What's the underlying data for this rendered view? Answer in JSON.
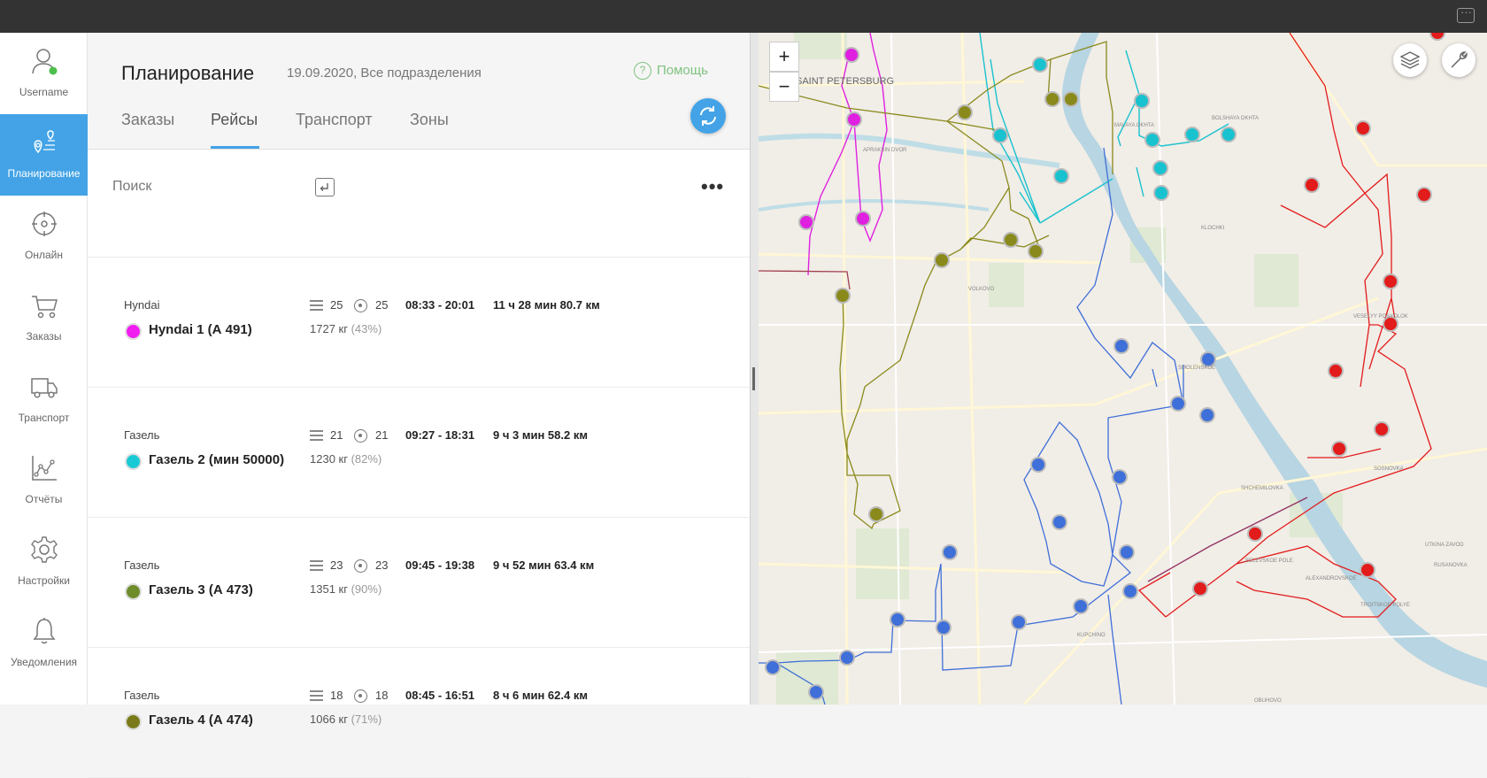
{
  "sidebar": {
    "items": [
      {
        "label": "Username",
        "icon": "user-icon"
      },
      {
        "label": "Планирование",
        "icon": "route-planning-icon",
        "active": true
      },
      {
        "label": "Онлайн",
        "icon": "crosshair-icon"
      },
      {
        "label": "Заказы",
        "icon": "cart-icon"
      },
      {
        "label": "Транспорт",
        "icon": "truck-icon"
      },
      {
        "label": "Отчёты",
        "icon": "chart-icon"
      },
      {
        "label": "Настройки",
        "icon": "gear-icon"
      },
      {
        "label": "Уведомления",
        "icon": "bell-icon"
      }
    ]
  },
  "header": {
    "title": "Планирование",
    "subtitle": "19.09.2020, Все подразделения",
    "help_label": "Помощь"
  },
  "tabs": [
    {
      "label": "Заказы"
    },
    {
      "label": "Рейсы",
      "active": true
    },
    {
      "label": "Транспорт"
    },
    {
      "label": "Зоны"
    }
  ],
  "search": {
    "label": "Поиск"
  },
  "trips": [
    {
      "type": "Hyndai",
      "name": "Hyndai 1 (А 491)",
      "color": "#f01cf0",
      "orders": "25",
      "points": "25",
      "time": "08:33 - 20:01",
      "duration": "11 ч 28 мин 80.7 км",
      "weight": "1727 кг",
      "percent": "(43%)"
    },
    {
      "type": "Газель",
      "name": "Газель 2 (мин 50000)",
      "color": "#19c9d6",
      "orders": "21",
      "points": "21",
      "time": "09:27 - 18:31",
      "duration": "9 ч 3 мин 58.2 км",
      "weight": "1230 кг",
      "percent": "(82%)"
    },
    {
      "type": "Газель",
      "name": "Газель 3 (А 473)",
      "color": "#6e8c2a",
      "orders": "23",
      "points": "23",
      "time": "09:45 - 19:38",
      "duration": "9 ч 52 мин 63.4 км",
      "weight": "1351 кг",
      "percent": "(90%)"
    },
    {
      "type": "Газель",
      "name": "Газель 4 (А 474)",
      "color": "#7a7a1a",
      "orders": "18",
      "points": "18",
      "time": "08:45 - 16:51",
      "duration": "8 ч 6 мин 62.4 км",
      "weight": "1066 кг",
      "percent": "(71%)"
    }
  ],
  "map": {
    "zoom_in": "+",
    "zoom_out": "−",
    "city_label": "SAINT PETERSBURG",
    "district_labels": [
      "VOLKOVO",
      "KLOCHKI",
      "VESELYY POSYOLOK",
      "SMOLENSKOE",
      "SOSNOVKA",
      "BELEVSKOE POLE",
      "ALEXANDROVSKOE",
      "TROITSKOE POLYE",
      "KUPCHINO",
      "OBUHOVO",
      "RUSANOVKA",
      "UTKINA ZAVOD",
      "SHCHEMILOVKA",
      "MALAYA OKHTA",
      "APRAKSIN DVOR",
      "BOLSHAYA OKHTA"
    ],
    "route_colors": {
      "magenta": "#e020e0",
      "cyan": "#19c2cf",
      "olive": "#7a7a14",
      "blue": "#3f6fd8",
      "red": "#e21b1b"
    }
  }
}
